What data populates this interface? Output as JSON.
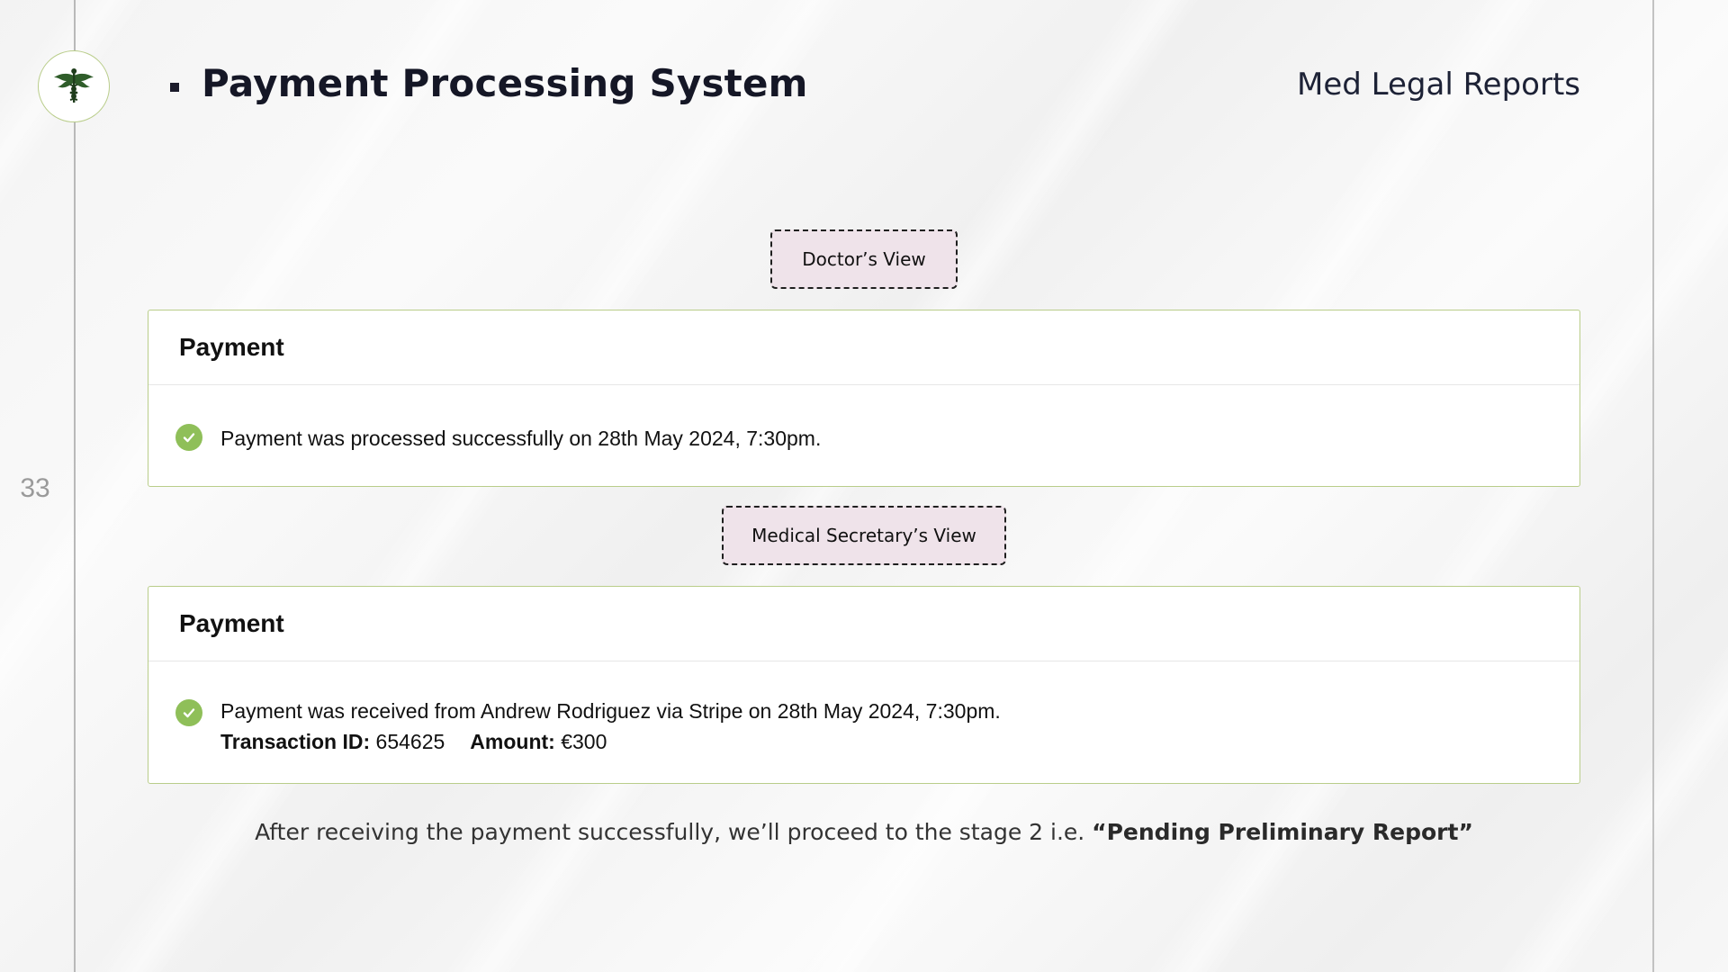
{
  "slide": {
    "page_number": "33",
    "title": "Payment Processing System",
    "brand": "Med Legal Reports"
  },
  "doctor_view": {
    "tag": "Doctor’s View",
    "card_title": "Payment",
    "message": "Payment was processed successfully on 28th May 2024, 7:30pm."
  },
  "secretary_view": {
    "tag": "Medical Secretary’s View",
    "card_title": "Payment",
    "message": "Payment was received from Andrew Rodriguez via Stripe on 28th May 2024, 7:30pm.",
    "transaction_label": "Transaction ID:",
    "transaction_id": "654625",
    "amount_label": "Amount:",
    "amount": "€300"
  },
  "footer": {
    "text": "After receiving the payment successfully, we’ll proceed to the stage 2 i.e. ",
    "highlight": "“Pending Preliminary Report”"
  },
  "colors": {
    "accent_green": "#8fbf59",
    "card_border": "#b9cd8a",
    "tag_fill": "#efe3ea"
  },
  "icons": {
    "logo": "caduceus-logo-icon",
    "status": "check-circle-icon"
  }
}
